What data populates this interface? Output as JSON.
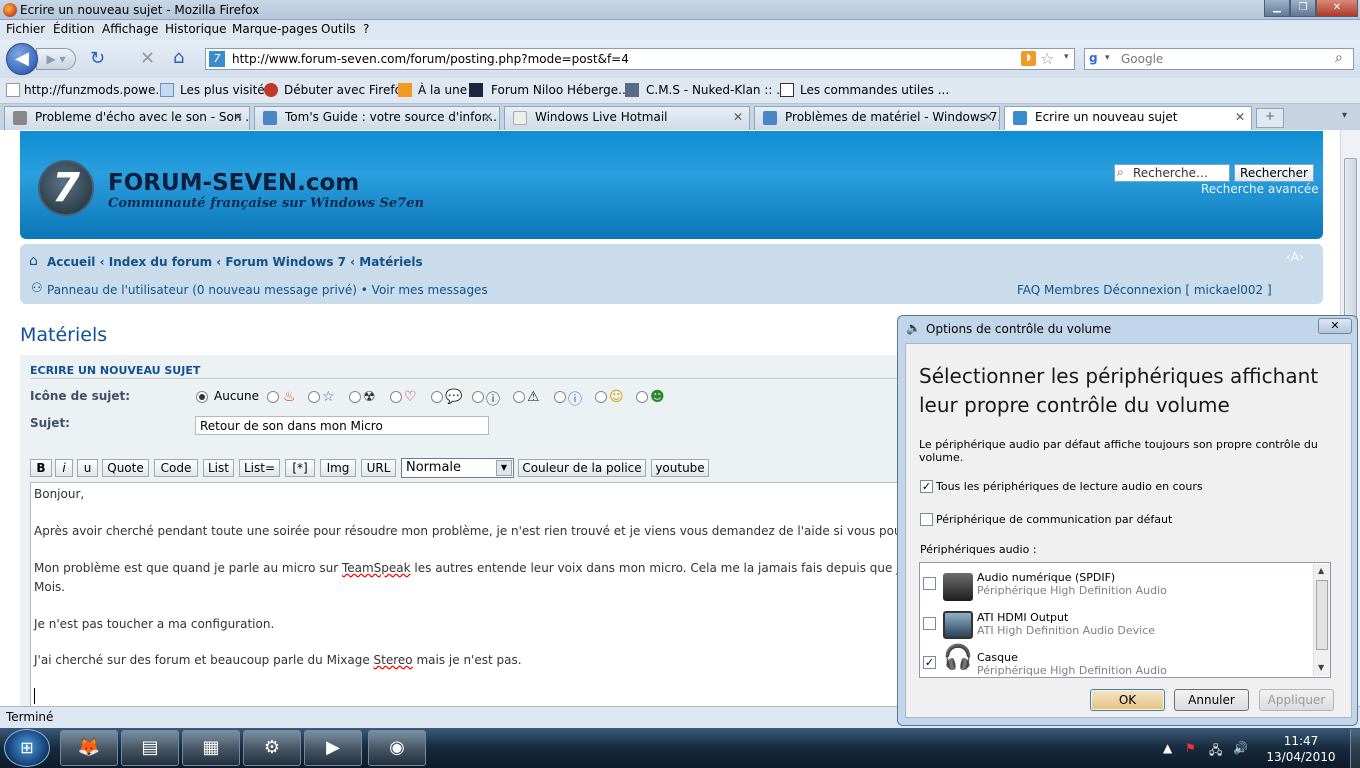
{
  "window": {
    "title": "Ecrire un nouveau sujet - Mozilla Firefox"
  },
  "menu": [
    "Fichier",
    "Édition",
    "Affichage",
    "Historique",
    "Marque-pages",
    "Outils",
    "?"
  ],
  "nav": {
    "url": "http://www.forum-seven.com/forum/posting.php?mode=post&f=4",
    "search_placeholder": "Google"
  },
  "bookmarks": [
    "http://funzmods.powe...",
    "Les plus visités",
    "Débuter avec Firefox",
    "À la une",
    "Forum Niloo Héberge...",
    "C.M.S - Nuked-Klan :: ...",
    "Les commandes utiles ..."
  ],
  "tabs": [
    {
      "label": "Probleme d'écho avec le son - Son ..."
    },
    {
      "label": "Tom's Guide : votre source d'infor..."
    },
    {
      "label": "Windows Live Hotmail"
    },
    {
      "label": "Problèmes de matériel - Windows 7..."
    },
    {
      "label": "Ecrire un nouveau sujet"
    }
  ],
  "site": {
    "brand": "FORUM-SEVEN.com",
    "tagline": "Communauté française sur Windows Se7en",
    "search_placeholder": "Recherche…",
    "search_button": "Rechercher",
    "advanced_search": "Recherche avancée",
    "breadcrumb": "Accueil ‹ Index du forum ‹ Forum Windows 7 ‹ Matériels",
    "user_links": "Panneau de l'utilisateur (0 nouveau message privé) • Voir mes messages",
    "right_links": "FAQ   Membres   Déconnexion [ mickael002 ]",
    "font_resize": "‹A›"
  },
  "page": {
    "title": "Matériels",
    "panel_title": "ECRIRE UN NOUVEAU SUJET",
    "icon_label": "Icône de sujet:",
    "icon_none": "Aucune",
    "subject_label": "Sujet:",
    "subject_value": "Retour de son dans mon Micro"
  },
  "toolbar": {
    "bold": "B",
    "italic": "i",
    "underline": "u",
    "quote": "Quote",
    "code": "Code",
    "list": "List",
    "list_eq": "List=",
    "list_item": "[*]",
    "img": "Img",
    "url": "URL",
    "size": "Normale",
    "color": "Couleur de la police",
    "youtube": "youtube"
  },
  "editor": {
    "line1": "Bonjour,",
    "line2": "Après avoir cherché pendant toute une soirée pour résoudre mon problème, je n'est rien trouvé et je viens vous demandez de l'aide si vous pouvez",
    "line3a": "Mon problème est que quand je parle au micro sur ",
    "line3_sq": "TeamSpeak",
    "line3b": " les autres entende leur voix dans mon micro. Cela me la jamais fais depuis que j'ai",
    "line4": "Mois.",
    "line5": "Je n'est pas toucher a ma configuration.",
    "line6a": "J'ai cherché sur des forum et beaucoup parle du Mixage ",
    "line6_sq": "Stereo",
    "line6b": " mais je n'est pas."
  },
  "status": {
    "text": "Terminé"
  },
  "taskbar": {
    "time": "11:47",
    "date": "13/04/2010"
  },
  "dialog": {
    "title": "Options de contrôle du volume",
    "heading": "Sélectionner les périphériques affichant leur propre contrôle du volume",
    "note": "Le périphérique audio par défaut affiche toujours son propre contrôle du volume.",
    "opt_all": "Tous les périphériques de lecture audio en cours",
    "opt_comm": "Périphérique de communication par défaut",
    "devices_label": "Périphériques audio :",
    "devices": [
      {
        "name": "Audio numérique (SPDIF)",
        "desc": "Périphérique High Definition Audio",
        "checked": false
      },
      {
        "name": "ATI HDMI Output",
        "desc": "ATI High Definition Audio Device",
        "checked": false
      },
      {
        "name": "Casque",
        "desc": "Périphérique High Definition Audio",
        "checked": true
      }
    ],
    "ok": "OK",
    "cancel": "Annuler",
    "apply": "Appliquer"
  }
}
